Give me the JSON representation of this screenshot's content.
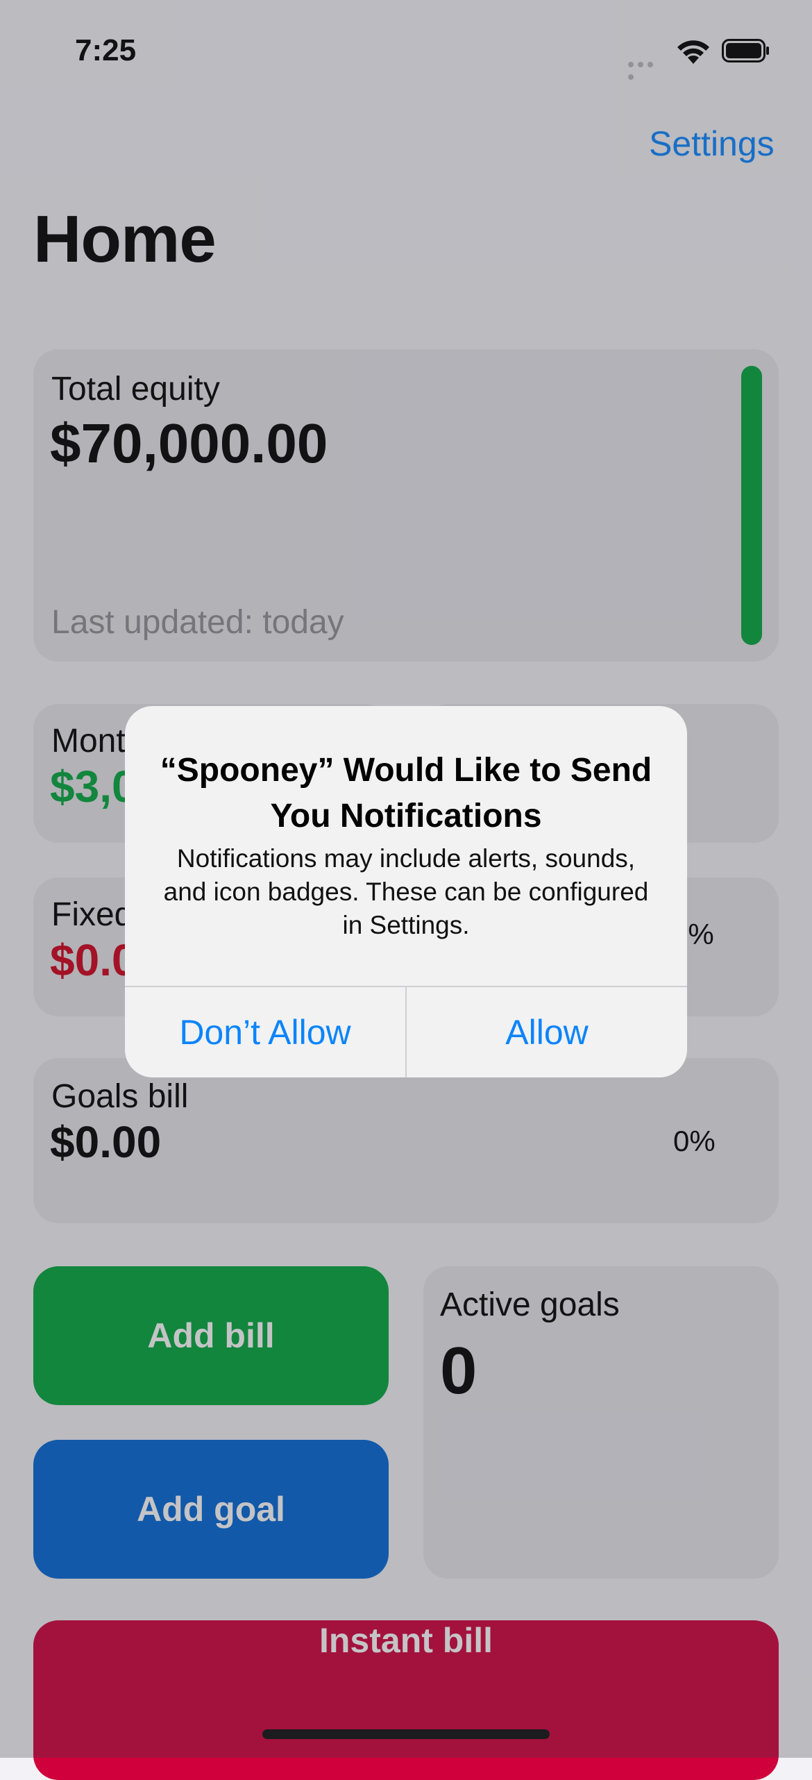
{
  "status_bar": {
    "time": "7:25"
  },
  "header": {
    "settings_label": "Settings",
    "title": "Home"
  },
  "equity_card": {
    "label": "Total equity",
    "value": "$70,000.00",
    "updated": "Last updated: today",
    "bar_color": "#00a63c"
  },
  "monthly_card": {
    "label_partial": "Mont",
    "value_partial": "$3,0",
    "value_color": "#00a63c"
  },
  "fixed_card": {
    "label_partial": "Fixed",
    "value_partial": "$0.0",
    "value_color": "#d0011b",
    "pct_partial": "0%"
  },
  "goals_bill_card": {
    "label": "Goals bill",
    "value": "$0.00",
    "pct": "0%"
  },
  "actions": {
    "add_bill": "Add bill",
    "add_goal": "Add goal",
    "instant_bill": "Instant bill",
    "colors": {
      "add_bill": "#00a63c",
      "add_goal": "#0066d6",
      "instant_bill": "#d0003c"
    }
  },
  "active_goals_card": {
    "label": "Active goals",
    "value": "0"
  },
  "alert": {
    "title": "“Spooney” Would Like to Send You Notifications",
    "message": "Notifications may include alerts, sounds, and icon badges. These can be configured in Settings.",
    "deny_label": "Don’t Allow",
    "allow_label": "Allow"
  }
}
